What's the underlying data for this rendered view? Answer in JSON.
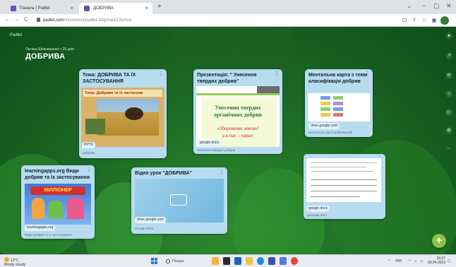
{
  "browser": {
    "tabs": [
      {
        "label": "Панель | Padlet",
        "close": "×"
      },
      {
        "label": "ДОБРИВА",
        "close": "×"
      }
    ],
    "new_tab": "+",
    "window_controls": {
      "minimize": "⌄",
      "restore": "−",
      "maximize": "▢",
      "close": "✕"
    },
    "nav": {
      "back": "←",
      "forward": "→",
      "reload": "C"
    },
    "url_domain": "padlet.com",
    "url_path": "/oxxxxxxxx/padlet-32gdcask13omce"
  },
  "board": {
    "logo": "Padlet",
    "author": "Оксана Шевчишенко • 25 днів",
    "title": "ДОБРИВА",
    "colors": {
      "card": "#b7dcef",
      "background": "#1d6b25",
      "fab": "#8bc34a"
    }
  },
  "cards": [
    {
      "title": "Тема: ДОБРИВА ТА ЇХ ЗАСТОСУВАННЯ",
      "banner": "Тема: Добрива та їх застосува",
      "chip": "PPTX",
      "source": "добрива"
    },
    {
      "title": "Презентація: \" Унесення твердих добрив\"",
      "slide_line1": "Унесення твердих",
      "slide_line2": "органічних добрив",
      "slide_line3": "«Збережемо землю!",
      "slide_line4": "а в нас – одна»",
      "chip": "google docs",
      "source": "Унесення твердих добрив"
    },
    {
      "title": "Ментальна карта з теми класифікація добрив",
      "chip": "drive.google.com",
      "source": "ментальна карта добрива.pdf"
    },
    {
      "title": "learningapps.org Види добрив та їх застосування",
      "game": "МІЛЛІОНЕР",
      "chip": "learningapps.org",
      "source": "Види добрив та їх застосування"
    },
    {
      "title": "Відео урок \"ДОБРИВА\"",
      "chip": "drive.google.com",
      "source": "Google Drive"
    },
    {
      "chip": "google docs",
      "source": "добрива.docx"
    }
  ],
  "sidebar_icons": [
    "settings-icon",
    "share-icon",
    "remake-icon",
    "comment-icon",
    "slideshow-icon",
    "gear-icon",
    "more-icon"
  ],
  "taskbar": {
    "weather_temp": "12°C",
    "weather_desc": "Mostly cloudy",
    "search": "Пошук",
    "lang": "УКР",
    "time": "15:37",
    "date": "03.04.2023"
  }
}
